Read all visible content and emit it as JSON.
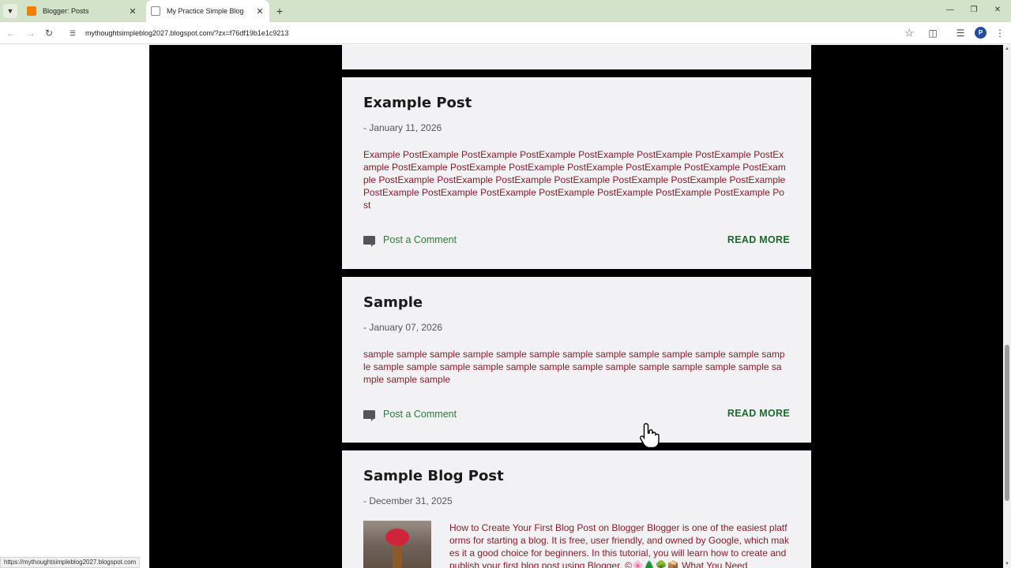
{
  "browser": {
    "tabs": [
      {
        "title": "Blogger: Posts",
        "active": false
      },
      {
        "title": "My Practice Simple Blog",
        "active": true
      }
    ],
    "url": "mythoughtsimpleblog2027.blogspot.com/?zx=f76df19b1e1c9213",
    "profile_initial": "P",
    "status_url": "https://mythoughtsimpleblog2027.blogspot.com"
  },
  "posts": [
    {
      "title": "Example Post",
      "date": "- January 11, 2026",
      "snippet": " Example PostExample PostExample PostExample PostExample PostExample PostExample PostExample PostExample PostExample PostExample PostExample PostExample PostExample PostExample PostExample PostExample PostExample PostExample PostExample PostExample PostExample PostExample PostExample PostExample PostExample PostExample PostExample PostExample Post",
      "comment_label": "Post a Comment",
      "read_more_label": "READ MORE"
    },
    {
      "title": "Sample",
      "date": "- January 07, 2026",
      "snippet": " sample sample sample sample sample sample sample sample sample sample sample sample sample sample sample sample sample sample sample sample sample sample sample sample sample sample sample sample",
      "comment_label": "Post a Comment",
      "read_more_label": "READ MORE"
    },
    {
      "title": "Sample Blog Post",
      "date": "- December 31, 2025",
      "snippet": "  How to Create Your First Blog Post on Blogger Blogger is one of the easiest platforms for starting a blog. It is free, user friendly, and owned by Google, which makes it a good choice for beginners. In this tutorial, you will learn how to create and publish your first blog post using Blogger. ©🌸🌲🌳📦 What You Need"
    }
  ]
}
